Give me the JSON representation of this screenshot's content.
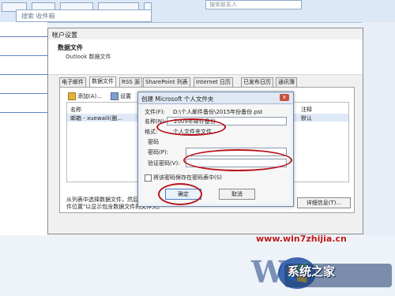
{
  "background": {
    "search_placeholder": "搜索 收件箱",
    "right_search_placeholder": "搜索联系人"
  },
  "account_dialog": {
    "title": "帐户设置",
    "header_title": "数据文件",
    "header_subtitle": "Outlook 数据文件",
    "tabs": [
      "电子邮件",
      "数据文件",
      "RSS 源",
      "SharePoint 列表",
      "Internet 日历",
      "已发布日历",
      "通讯簿"
    ],
    "active_tab": "数据文件",
    "toolbar": {
      "add_label": "添加(A)...",
      "settings_label": "设置"
    },
    "list": {
      "columns": [
        "名称",
        "注释"
      ],
      "rows": [
        {
          "name": "邮箱 - xuewaili(删...",
          "note": "默认"
        }
      ]
    },
    "info_text": "从列表中选择数据文件，然后单击\"设置\"以获取详细信息，或单击\"打开文件位置\"以显示包含数据文件的文件夹。",
    "details_button": "详细信息(T)..."
  },
  "create_dialog": {
    "title": "创建 Microsoft 个人文件夹",
    "close_glyph": "x",
    "file_label": "文件(F):",
    "file_value": "D:\\个人邮件备份\\2015年份备份.pst",
    "name_label": "名称(N):",
    "name_value": "2009年邮件备份",
    "format_label": "格式:",
    "format_value": "个人文件夹文件",
    "password_section": "密码",
    "password_label": "密码(P):",
    "verify_label": "验证密码(V):",
    "save_password_label": "将该密码保存在密码表中(S)",
    "ok_label": "确定",
    "cancel_label": "取消"
  },
  "watermark": {
    "url": "www.win7zhijia.cn",
    "brand_text": "系统之家"
  },
  "colors": {
    "annotation_ring": "#b8141c",
    "watermark_red": "#c21b1b",
    "dialog_border": "#6e89ad"
  }
}
